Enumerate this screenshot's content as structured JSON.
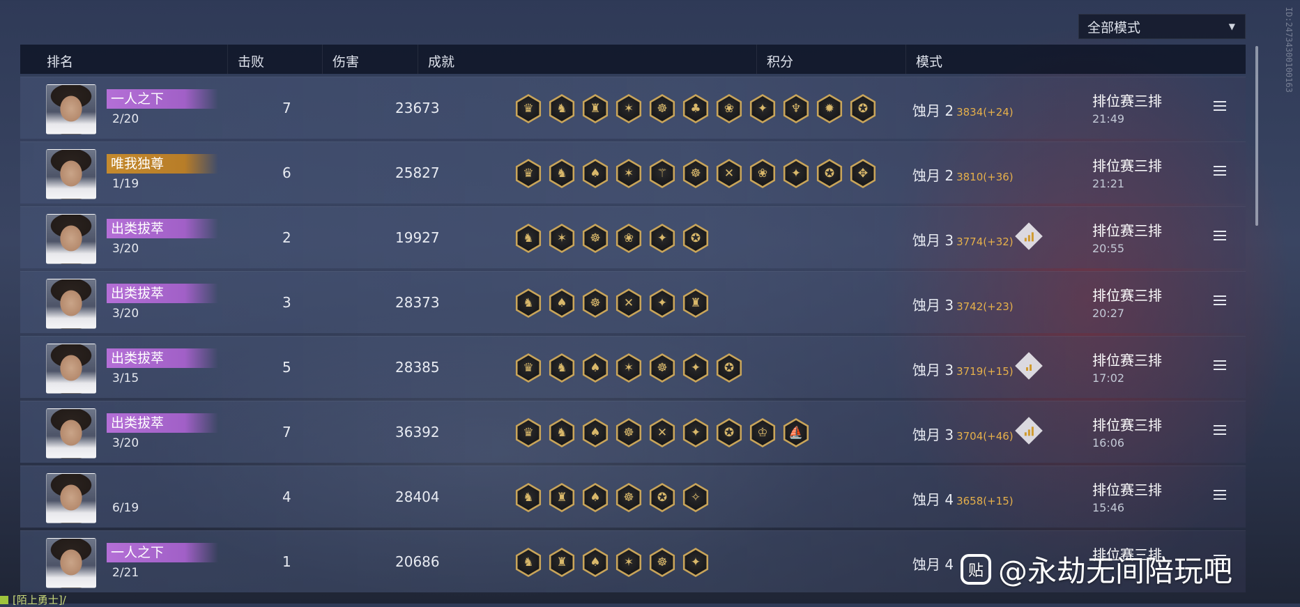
{
  "mode_filter": {
    "selected": "全部模式"
  },
  "side_id": "ID:24734300100163",
  "headers": {
    "rank": "排名",
    "kills": "击败",
    "damage": "伤害",
    "achievements": "成就",
    "score": "积分",
    "mode": "模式"
  },
  "rows": [
    {
      "title": "一人之下",
      "title_color": "purple",
      "rank": "2/20",
      "kills": "7",
      "damage": "23673",
      "achievements": [
        "♛",
        "♞",
        "♜",
        "✶",
        "☸",
        "♣",
        "❀",
        "✦",
        "♆",
        "✹",
        "✪"
      ],
      "tier": "蚀月 2",
      "points": "3834(+24)",
      "rise": null,
      "mode": "排位赛三排",
      "time": "21:49"
    },
    {
      "title": "唯我独尊",
      "title_color": "gold",
      "rank": "1/19",
      "kills": "6",
      "damage": "25827",
      "achievements": [
        "♛",
        "♞",
        "♠",
        "✶",
        "⚚",
        "☸",
        "✕",
        "❀",
        "✦",
        "✪",
        "✥"
      ],
      "tier": "蚀月 2",
      "points": "3810(+36)",
      "rise": null,
      "mode": "排位赛三排",
      "time": "21:21"
    },
    {
      "title": "出类拔萃",
      "title_color": "purple",
      "rank": "3/20",
      "kills": "2",
      "damage": "19927",
      "achievements": [
        "♞",
        "✶",
        "☸",
        "❀",
        "✦",
        "✪"
      ],
      "tier": "蚀月 3",
      "points": "3774(+32)",
      "rise": 3,
      "mode": "排位赛三排",
      "time": "20:55"
    },
    {
      "title": "出类拔萃",
      "title_color": "purple",
      "rank": "3/20",
      "kills": "3",
      "damage": "28373",
      "achievements": [
        "♞",
        "♠",
        "☸",
        "✕",
        "✦",
        "♜"
      ],
      "tier": "蚀月 3",
      "points": "3742(+23)",
      "rise": null,
      "mode": "排位赛三排",
      "time": "20:27"
    },
    {
      "title": "出类拔萃",
      "title_color": "purple",
      "rank": "3/15",
      "kills": "5",
      "damage": "28385",
      "achievements": [
        "♛",
        "♞",
        "♠",
        "✶",
        "☸",
        "✦",
        "✪"
      ],
      "tier": "蚀月 3",
      "points": "3719(+15)",
      "rise": 2,
      "mode": "排位赛三排",
      "time": "17:02"
    },
    {
      "title": "出类拔萃",
      "title_color": "purple",
      "rank": "3/20",
      "kills": "7",
      "damage": "36392",
      "achievements": [
        "♛",
        "♞",
        "♠",
        "☸",
        "✕",
        "✦",
        "✪",
        "♔",
        "⛵"
      ],
      "tier": "蚀月 3",
      "points": "3704(+46)",
      "rise": 3,
      "mode": "排位赛三排",
      "time": "16:06"
    },
    {
      "title": "",
      "title_color": "none",
      "rank": "6/19",
      "kills": "4",
      "damage": "28404",
      "achievements": [
        "♞",
        "♜",
        "♠",
        "☸",
        "✪",
        "✧"
      ],
      "tier": "蚀月 4",
      "points": "3658(+15)",
      "rise": null,
      "mode": "排位赛三排",
      "time": "15:46"
    },
    {
      "title": "一人之下",
      "title_color": "purple",
      "rank": "2/21",
      "kills": "1",
      "damage": "20686",
      "achievements": [
        "♞",
        "♜",
        "♠",
        "✶",
        "☸",
        "✦"
      ],
      "tier": "蚀月 4",
      "points": "",
      "rise": null,
      "mode": "排位赛三排",
      "time": ""
    }
  ],
  "watermark": {
    "logo": "贴",
    "text": "@永劫无间陪玩吧"
  },
  "chat": {
    "text": "[陌上勇士]/"
  }
}
